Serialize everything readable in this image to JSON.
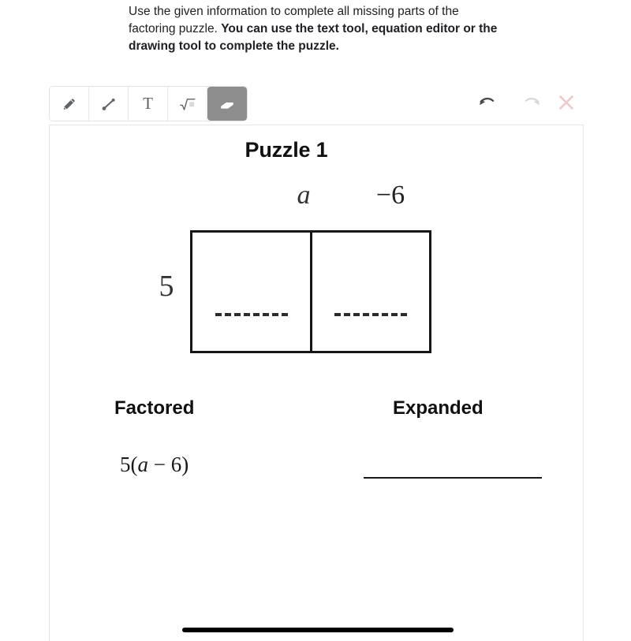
{
  "instructions": {
    "normal_text": "Use the given information to complete all missing parts of the factoring puzzle. ",
    "bold_text": "You can use the text tool, equation editor or the drawing tool to complete the puzzle."
  },
  "toolbar": {
    "tools": [
      {
        "id": "pencil",
        "icon": "pencil-icon",
        "label": "Pencil",
        "selected": false
      },
      {
        "id": "line",
        "icon": "line-icon",
        "label": "Line",
        "selected": false
      },
      {
        "id": "text",
        "icon": "text-icon",
        "label": "T",
        "selected": false
      },
      {
        "id": "equation-editor",
        "icon": "square-root-icon",
        "label": "Equation editor",
        "selected": false
      },
      {
        "id": "eraser",
        "icon": "eraser-icon",
        "label": "Eraser",
        "selected": true
      }
    ],
    "selected_tool": "eraser"
  },
  "actions": {
    "undo": {
      "label": "Undo",
      "icon": "undo-arrow-icon",
      "enabled": true,
      "color": "#4a4a4a"
    },
    "redo": {
      "label": "Redo",
      "icon": "redo-arrow-icon",
      "enabled": false,
      "color": "#d6d6d6"
    },
    "close": {
      "label": "Close",
      "icon": "close-x-icon",
      "enabled": true,
      "color": "#eec9c9"
    }
  },
  "worksheet": {
    "title": "Puzzle 1",
    "column_labels": {
      "left": "a",
      "right": "−6"
    },
    "row_label": "5",
    "cells": [
      {
        "position": "left",
        "value": "",
        "placeholder": "dashed-blank"
      },
      {
        "position": "right",
        "value": "",
        "placeholder": "dashed-blank"
      }
    ],
    "headings": {
      "factored": "Factored",
      "expanded": "Expanded"
    },
    "factored_expression": {
      "coefficient": "5(",
      "variable": "a",
      "operator": " − 6)"
    },
    "expanded_answer": "",
    "drawn_stroke": {
      "present": true,
      "color": "#000000"
    }
  }
}
